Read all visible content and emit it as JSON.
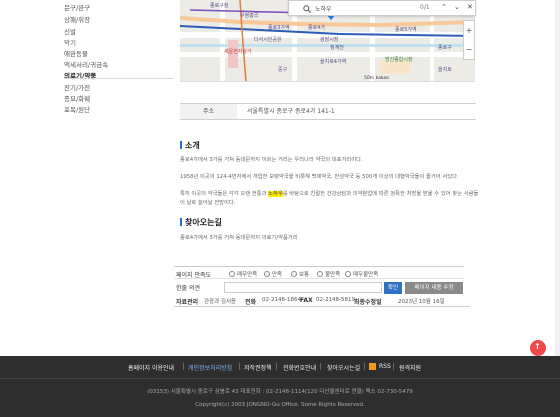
{
  "sidebar": {
    "items": [
      {
        "label": "문구/완구",
        "active": false
      },
      {
        "label": "상패/휘장",
        "active": false
      },
      {
        "label": "신발",
        "active": false
      },
      {
        "label": "악기",
        "active": false
      },
      {
        "label": "애완동물",
        "active": false
      },
      {
        "label": "액세서리/귀금속",
        "active": false
      },
      {
        "label": "의료기/약품",
        "active": true
      },
      {
        "label": "전기/가전",
        "active": false
      },
      {
        "label": "종묘/화훼",
        "active": false
      },
      {
        "label": "포목/원단",
        "active": false
      }
    ]
  },
  "map": {
    "search_query": "노하우",
    "result_count": "0/1",
    "labels": [
      {
        "text": "종로구청",
        "color": "purple"
      },
      {
        "text": "우정총국",
        "color": "purple"
      },
      {
        "text": "종로3가역",
        "color": "purple"
      },
      {
        "text": "다서시민공원",
        "color": "purple"
      },
      {
        "text": "종로4가",
        "color": "purple"
      },
      {
        "text": "광장시장",
        "color": "purple"
      },
      {
        "text": "세운전자상가",
        "color": "red"
      },
      {
        "text": "청계천",
        "color": "purple"
      },
      {
        "text": "종로5가역",
        "color": "purple"
      },
      {
        "text": "을지로4가역",
        "color": "purple"
      },
      {
        "text": "방산종합시장",
        "color": "green"
      },
      {
        "text": "중구",
        "color": "purple"
      },
      {
        "text": "을지로",
        "color": "purple"
      },
      {
        "text": "종로구",
        "color": "purple"
      }
    ],
    "scale": "50m",
    "kakao": "kakao",
    "zoom_in": "+",
    "zoom_out": "−"
  },
  "address": {
    "label": "주소",
    "value": "서울특별시 종로구 종로4가 141-1"
  },
  "intro": {
    "title": "소개",
    "p1": "종로4가에서 3가를 거쳐 동대문까지 이르는 거리는 우리나라 약국의 대표거리이다.",
    "p2": "1958년 이곳의 124-4번지에서 개업한 보령약국을 비롯해 백제약국, 한성약국 등 500개 이상의 대형약국들이 즐거어 서있다.",
    "p3_before": "특히 이곳의 약국들은 각각 오랜 전통과 ",
    "p3_highlight": "노하우",
    "p3_after": "를 바탕으로 친절한 건강상담과 의약분업에 따른 정확한 처방을 받을 수 있어 찾는 사람들이 날로 늘어날 전망이다."
  },
  "directions": {
    "title": "찾아오는길",
    "p1": "종로4가에서 3가를 거쳐 동대문까지 의료기/약품거리"
  },
  "rating": {
    "label": "페이지 만족도",
    "options": [
      "매우만족",
      "만족",
      "보통",
      "불만족",
      "매우불만족"
    ]
  },
  "comment": {
    "label": "한줄 의견",
    "confirm": "확인",
    "edit": "페이지 내용 수정"
  },
  "meta": {
    "manager_label": "자료관리",
    "manager": "관광과 김서윤",
    "tel_label": "전화",
    "tel": "02-2148-1864",
    "fax_label": "FAX",
    "fax": "02-2148-5819",
    "updated_label": "최종수정일",
    "updated": "2023년 10월 16일"
  },
  "footer": {
    "links": [
      "홈페이지 이용안내",
      "개인정보처리방침",
      "저작권정책",
      "전화번호안내",
      "찾아오시는길",
      "RSS",
      "원격지원"
    ],
    "address": "(03153) 서울특별시 종로구 삼봉로 43 대표전화 : 02-2148-1114(120 다산콜센터로 연결) 팩스 02-730-5479",
    "copyright": "Copyright(c) 2003 JONGNO-Gu Office. Some Rights Reserved."
  },
  "top_button": "↑",
  "colors": {
    "accent": "#1f6fd1",
    "highlight": "#ffef00",
    "footer_bg": "#2e2e2e",
    "top_button": "#ef4a4a"
  }
}
